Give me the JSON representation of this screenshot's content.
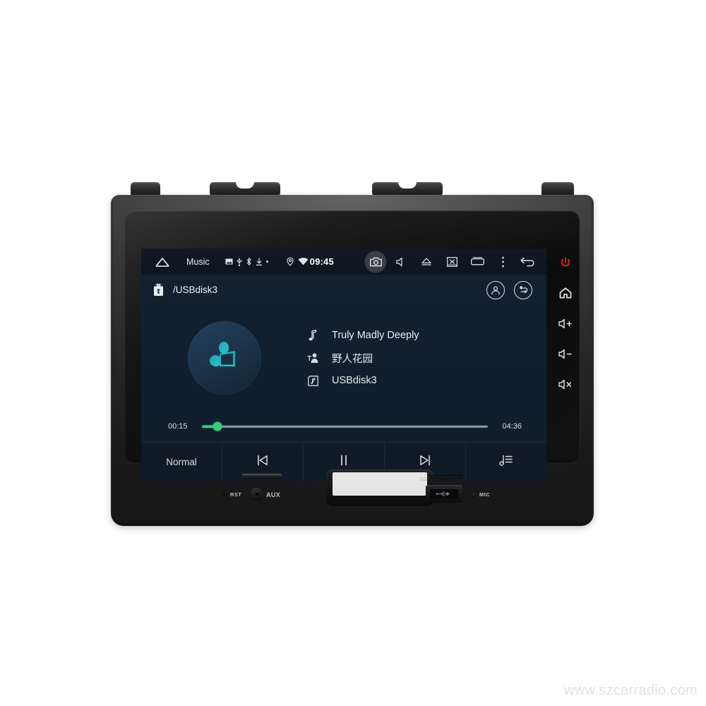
{
  "product": {
    "watermark": "www.szcarradio.com"
  },
  "statusbar": {
    "home_icon": "home-outline-icon",
    "app_label": "Music",
    "left_icons": [
      {
        "name": "screenshot-icon"
      },
      {
        "name": "usb-icon"
      },
      {
        "name": "bluetooth-icon"
      },
      {
        "name": "download-icon"
      },
      {
        "name": "dot-indicator-icon"
      }
    ],
    "mid_icons": [
      {
        "name": "location-pin-icon"
      },
      {
        "name": "wifi-icon"
      }
    ],
    "clock": "09:45",
    "right_icons": [
      {
        "name": "camera-icon",
        "highlighted": true
      },
      {
        "name": "volume-mute-icon",
        "highlighted": false
      },
      {
        "name": "eject-icon",
        "highlighted": false
      },
      {
        "name": "close-screen-icon",
        "highlighted": false
      },
      {
        "name": "recent-apps-icon",
        "highlighted": false
      },
      {
        "name": "overflow-menu-icon",
        "highlighted": false
      },
      {
        "name": "back-arrow-icon",
        "highlighted": false
      }
    ]
  },
  "player": {
    "source_icon": "usb-drive-icon",
    "source_label": "/USBdisk3",
    "account_icon": "account-circle-icon",
    "repeat_icon": "repeat-circle-icon",
    "album_art_icon": "music-note-album-art",
    "track": {
      "title": "Truly Madly Deeply",
      "title_icon": "music-note-icon",
      "artist": "野人花园",
      "artist_icon": "artist-icon",
      "album": "USBdisk3",
      "album_icon": "album-icon"
    },
    "seek": {
      "elapsed": "00:15",
      "duration": "04:36",
      "progress_percent": 5.4,
      "accent_color": "#3ddc84"
    },
    "controls": {
      "mode_label": "Normal",
      "previous_icon": "skip-previous-icon",
      "play_pause_icon": "pause-icon",
      "next_icon": "skip-next-icon",
      "playlist_icon": "playlist-icon"
    }
  },
  "hardware": {
    "side_buttons": [
      {
        "name": "power-button",
        "icon": "power-icon",
        "color": "#d81f1f"
      },
      {
        "name": "home-button",
        "icon": "home-icon",
        "color": "#e8e8e8"
      },
      {
        "name": "volume-up-button",
        "icon": "volume-up-icon",
        "color": "#e8e8e8"
      },
      {
        "name": "volume-down-button",
        "icon": "volume-down-icon",
        "color": "#e8e8e8"
      },
      {
        "name": "mute-button",
        "icon": "volume-mute-icon",
        "color": "#e8e8e8"
      }
    ],
    "ports": {
      "reset_label": "RST",
      "aux_label": "AUX",
      "sd_label": "SD",
      "mic_label": "MIC"
    }
  }
}
